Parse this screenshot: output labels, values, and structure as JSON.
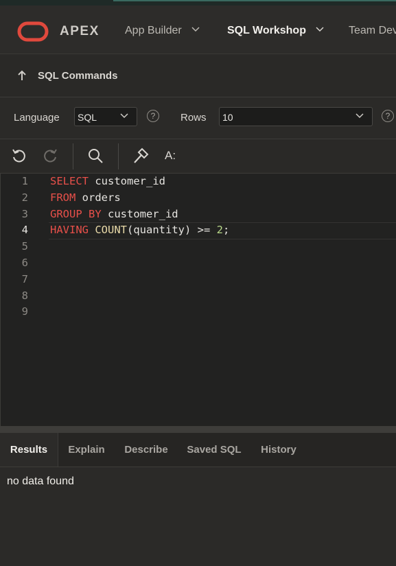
{
  "header": {
    "brand": "APEX",
    "nav": [
      {
        "label": "App Builder"
      },
      {
        "label": "SQL Workshop"
      },
      {
        "label": "Team Dev"
      }
    ]
  },
  "breadcrumb": {
    "title": "SQL Commands"
  },
  "settings": {
    "language_label": "Language",
    "language_value": "SQL",
    "rows_label": "Rows",
    "rows_value": "10",
    "help_glyph": "?"
  },
  "editor": {
    "line_numbers": [
      "1",
      "2",
      "3",
      "4",
      "5",
      "6",
      "7",
      "8",
      "9"
    ],
    "active_line": 4,
    "code": [
      [
        {
          "t": "SELECT",
          "c": "kw"
        },
        {
          "t": " customer_id",
          "c": ""
        }
      ],
      [
        {
          "t": "FROM",
          "c": "kw"
        },
        {
          "t": " orders",
          "c": ""
        }
      ],
      [
        {
          "t": "GROUP BY",
          "c": "kw"
        },
        {
          "t": " customer_id",
          "c": ""
        }
      ],
      [
        {
          "t": "HAVING",
          "c": "kw"
        },
        {
          "t": " ",
          "c": ""
        },
        {
          "t": "COUNT",
          "c": "fn"
        },
        {
          "t": "(quantity) >= ",
          "c": ""
        },
        {
          "t": "2",
          "c": "num"
        },
        {
          "t": ";",
          "c": ""
        }
      ]
    ],
    "colors": {
      "keyword": "#e8504a",
      "function": "#e8d9a8",
      "number": "#b9d98a"
    }
  },
  "toolbar_icons": [
    "undo-icon",
    "redo-icon",
    "search-icon",
    "hammer-icon",
    "format-icon"
  ],
  "format_glyph": "A:",
  "tabs": [
    {
      "label": "Results"
    },
    {
      "label": "Explain"
    },
    {
      "label": "Describe"
    },
    {
      "label": "Saved SQL"
    },
    {
      "label": "History"
    }
  ],
  "results": {
    "message": "no data found"
  }
}
